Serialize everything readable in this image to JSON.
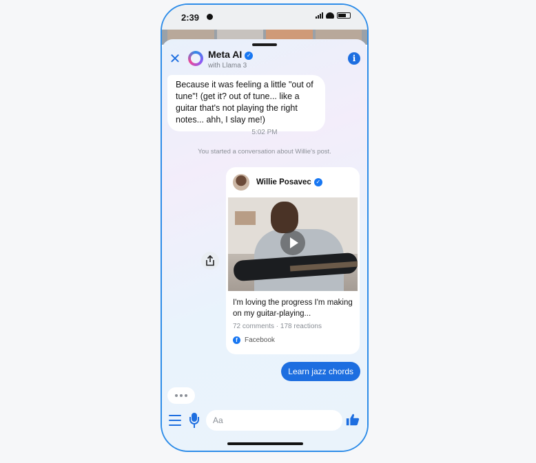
{
  "status_bar": {
    "time": "2:39"
  },
  "header": {
    "title": "Meta AI",
    "subtitle": "with Llama 3",
    "icons": [
      "close-icon",
      "meta-ai-icon",
      "verified-icon",
      "info-icon"
    ]
  },
  "messages": {
    "ai_text": "Because it was feeling a little \"out of tune\"! (get it? out of tune... like a guitar that's not playing the right notes... ahh, I slay me!)",
    "timestamp": "5:02 PM",
    "system_note": "You started a conversation about Willie's post.",
    "user_text": "Learn jazz chords"
  },
  "post": {
    "author": "Willie Posavec",
    "text": "I'm loving the progress I'm making on my guitar-playing...",
    "meta": "72 comments · 178 reactions",
    "source": "Facebook"
  },
  "composer": {
    "placeholder": "Aa"
  },
  "colors": {
    "accent": "#1d6ee0",
    "frame": "#2d8ce8",
    "facebook": "#1877f2"
  }
}
